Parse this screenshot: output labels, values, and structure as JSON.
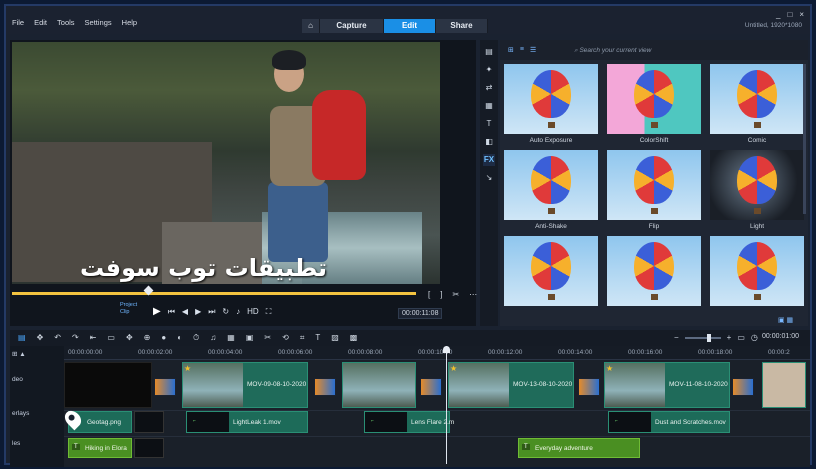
{
  "menu": [
    "File",
    "Edit",
    "Tools",
    "Settings",
    "Help"
  ],
  "tabs": {
    "capture": "Capture",
    "edit": "Edit",
    "share": "Share"
  },
  "window": {
    "project_info": "Untitled, 1920*1080",
    "minimize": "_",
    "maximize": "□",
    "close": "×"
  },
  "player": {
    "watermark": "تطبيقات توب سوفت",
    "project_label": "Project",
    "clip_label": "Clip",
    "timecode": "00:00:11:08",
    "hd_label": "HD",
    "playback_progress": 0.33
  },
  "library": {
    "search_placeholder": "Search your current view",
    "effects": [
      {
        "label": "Auto Exposure",
        "style": "normal"
      },
      {
        "label": "ColorShift",
        "style": "tint"
      },
      {
        "label": "Comic",
        "style": "normal"
      },
      {
        "label": "Anti-Shake",
        "style": "normal"
      },
      {
        "label": "Flip",
        "style": "normal"
      },
      {
        "label": "Light",
        "style": "dark"
      },
      {
        "label": "",
        "style": "normal"
      },
      {
        "label": "",
        "style": "normal"
      },
      {
        "label": "",
        "style": "normal"
      }
    ],
    "side_tools": [
      "media-icon",
      "instant-project-icon",
      "transition-icon",
      "graphics-icon",
      "title-icon",
      "overlay-icon",
      "FX",
      "path-icon"
    ]
  },
  "timeline": {
    "timecode": "00:00:01:00",
    "ruler": [
      "00:00:00:00",
      "00:00:02:00",
      "00:00:04:00",
      "00:00:06:00",
      "00:00:08:00",
      "00:00:10:00",
      "00:00:12:00",
      "00:00:14:00",
      "00:00:16:00",
      "00:00:18:00",
      "00:00:2"
    ],
    "track_labels": [
      "deo",
      "erlays",
      "les"
    ],
    "video_clips": [
      "MOV-09-08-10-2020",
      "MOV-13-08-10-2020",
      "MOV-11-08-10-2020"
    ],
    "overlay_clips": [
      "Geotag.png",
      "LightLeak 1.mov",
      "Lens Flare 2.m",
      "Dust and Scratches.mov"
    ],
    "title_clips": [
      "Hiking in Elora",
      "Everyday adventure"
    ]
  }
}
